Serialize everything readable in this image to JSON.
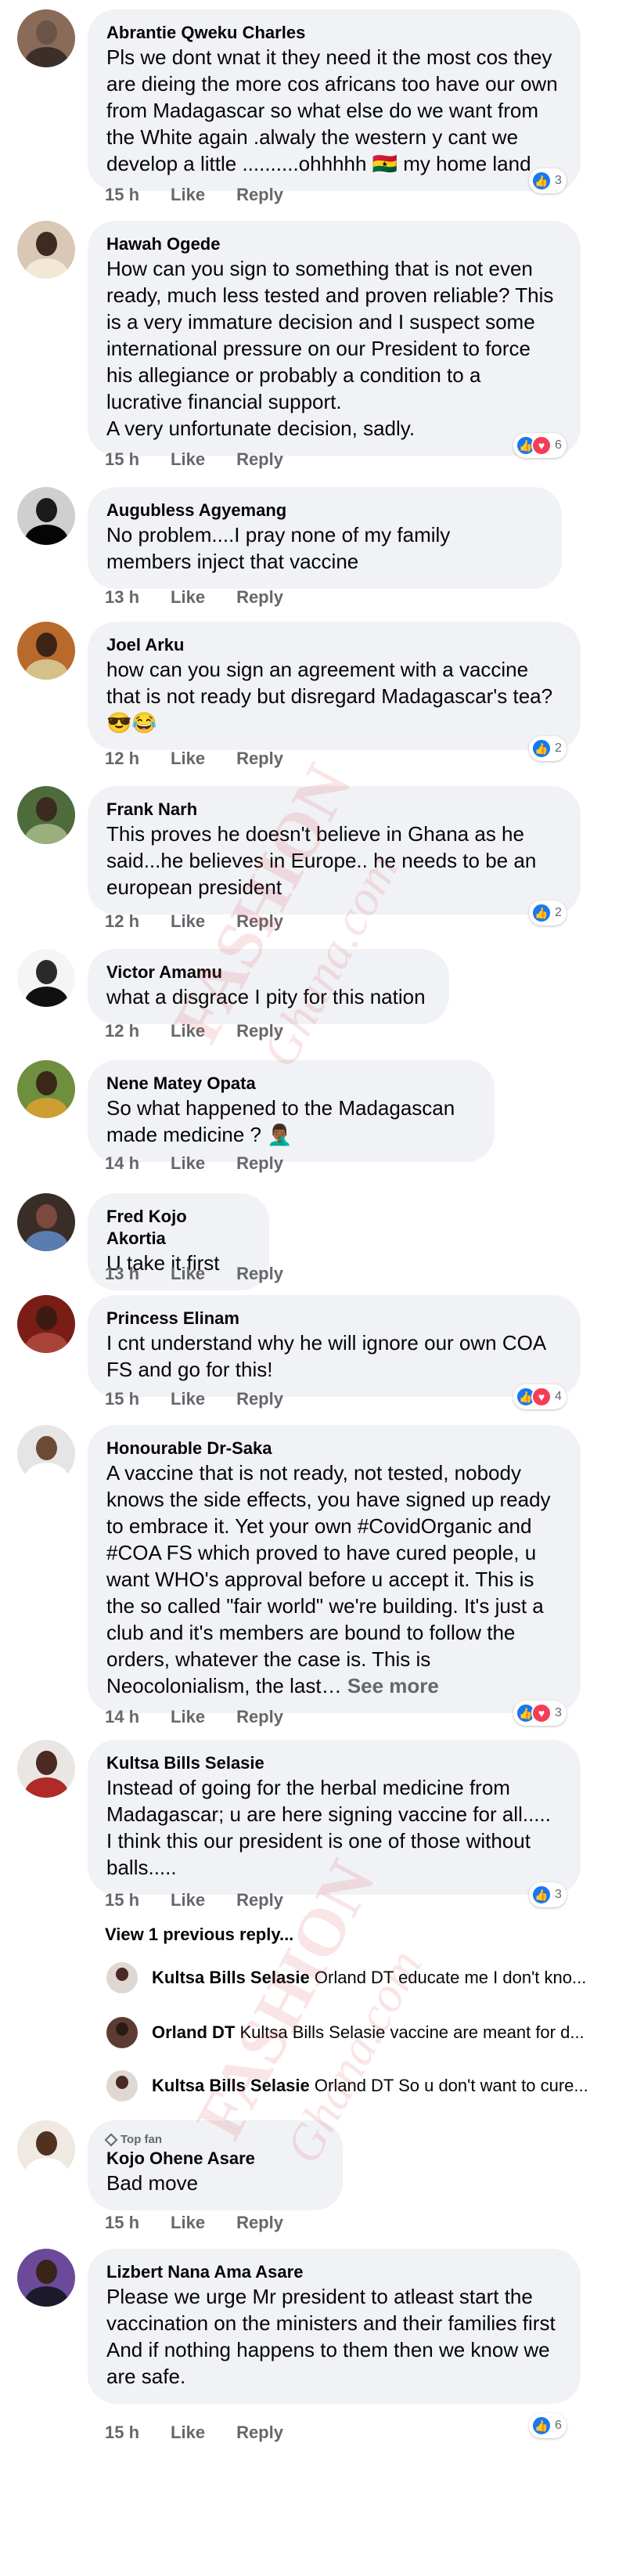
{
  "comments": [
    {
      "author": "Abrantie Qweku Charles",
      "text": "Pls we dont wnat it they need it the most cos they are dieing the more cos africans too have our own from Madagascar so what else do we want from the White again .alwaly the western y cant we develop a little ..........ohhhhh 🇬🇭 my home land",
      "time": "15 h",
      "like": "Like",
      "reply": "Reply",
      "reactions": [
        "like"
      ],
      "reaction_count": "3"
    },
    {
      "author": "Hawah Ogede",
      "text": "How can you sign to something that is not even ready, much less tested and proven reliable? This is a very immature decision and I suspect some international pressure on our President to force his allegiance or probably a condition to a lucrative financial support.\nA very unfortunate decision, sadly.",
      "time": "15 h",
      "like": "Like",
      "reply": "Reply",
      "reactions": [
        "like",
        "love"
      ],
      "reaction_count": "6"
    },
    {
      "author": "Augubless Agyemang",
      "text": "No problem....I pray none of my family members inject that vaccine",
      "time": "13 h",
      "like": "Like",
      "reply": "Reply",
      "reactions": [],
      "reaction_count": ""
    },
    {
      "author": "Joel Arku",
      "text": "how can you sign an agreement with a vaccine that is not ready but disregard Madagascar's tea? 😎😂",
      "time": "12 h",
      "like": "Like",
      "reply": "Reply",
      "reactions": [
        "like"
      ],
      "reaction_count": "2"
    },
    {
      "author": "Frank Narh",
      "text": "This proves he doesn't believe in  Ghana as he said...he believes in Europe.. he needs to be an european president",
      "time": "12 h",
      "like": "Like",
      "reply": "Reply",
      "reactions": [
        "like"
      ],
      "reaction_count": "2"
    },
    {
      "author": "Victor Amamu",
      "text": "what a disgrace I pity for this nation",
      "time": "12 h",
      "like": "Like",
      "reply": "Reply",
      "reactions": [],
      "reaction_count": ""
    },
    {
      "author": "Nene Matey Opata",
      "text": "So what happened to the Madagascan made medicine ? 🤦🏾‍♂️",
      "time": "14 h",
      "like": "Like",
      "reply": "Reply",
      "reactions": [],
      "reaction_count": ""
    },
    {
      "author": "Fred Kojo Akortia",
      "text": "U take it first",
      "time": "13 h",
      "like": "Like",
      "reply": "Reply",
      "reactions": [],
      "reaction_count": ""
    },
    {
      "author": "Princess Elinam",
      "text": "I cnt understand why he will ignore our own COA FS and go for this!",
      "time": "15 h",
      "like": "Like",
      "reply": "Reply",
      "reactions": [
        "like",
        "love"
      ],
      "reaction_count": "4"
    },
    {
      "author": "Honourable Dr-Saka",
      "text": "A vaccine that is not ready, not tested, nobody knows the side effects, you have signed up ready to embrace it. Yet your own #CovidOrganic and #COA FS which proved to have cured people, u want WHO's approval before u accept it. This is the so called \"fair world\" we're building. It's just a club and it's members are bound to follow the orders, whatever the case is. This is Neocolonialism, the last…",
      "see_more": "See more",
      "time": "14 h",
      "like": "Like",
      "reply": "Reply",
      "reactions": [
        "like",
        "love"
      ],
      "reaction_count": "3"
    },
    {
      "author": "Kultsa Bills Selasie",
      "text": "Instead of going for the herbal medicine from Madagascar; u are here signing vaccine for all..... I think this our president is one of those without balls.....",
      "time": "15 h",
      "like": "Like",
      "reply": "Reply",
      "reactions": [
        "like"
      ],
      "reaction_count": "3"
    },
    {
      "author": "Kojo Ohene Asare",
      "badge": "Top fan",
      "text": "Bad move",
      "time": "15 h",
      "like": "Like",
      "reply": "Reply",
      "reactions": [],
      "reaction_count": ""
    },
    {
      "author": "Lizbert Nana Ama Asare",
      "text": "Please we urge Mr president to atleast start the vaccination on the ministers and their families first\nAnd if nothing happens to them then we know we are safe.",
      "time": "15 h",
      "like": "Like",
      "reply": "Reply",
      "reactions": [
        "like"
      ],
      "reaction_count": "6"
    }
  ],
  "view_previous": "View 1 previous reply...",
  "replies": [
    {
      "author": "Kultsa Bills Selasie",
      "text": "Orland DT educate me I don't kno..."
    },
    {
      "author": "Orland DT",
      "text": "Kultsa Bills Selasie vaccine are meant for d..."
    },
    {
      "author": "Kultsa Bills Selasie",
      "text": "Orland DT So u don't want to cure..."
    }
  ],
  "watermark": {
    "line1": "FASHION",
    "line2": "Ghana.com"
  },
  "colors": {
    "bubble": "#f0f2f5",
    "meta": "#65676b",
    "like": "#1877f2",
    "love": "#f33e58",
    "watermark": "#dc4650"
  },
  "icons": {
    "like": "thumbs-up-icon",
    "love": "heart-icon",
    "top_fan": "diamond-icon"
  }
}
